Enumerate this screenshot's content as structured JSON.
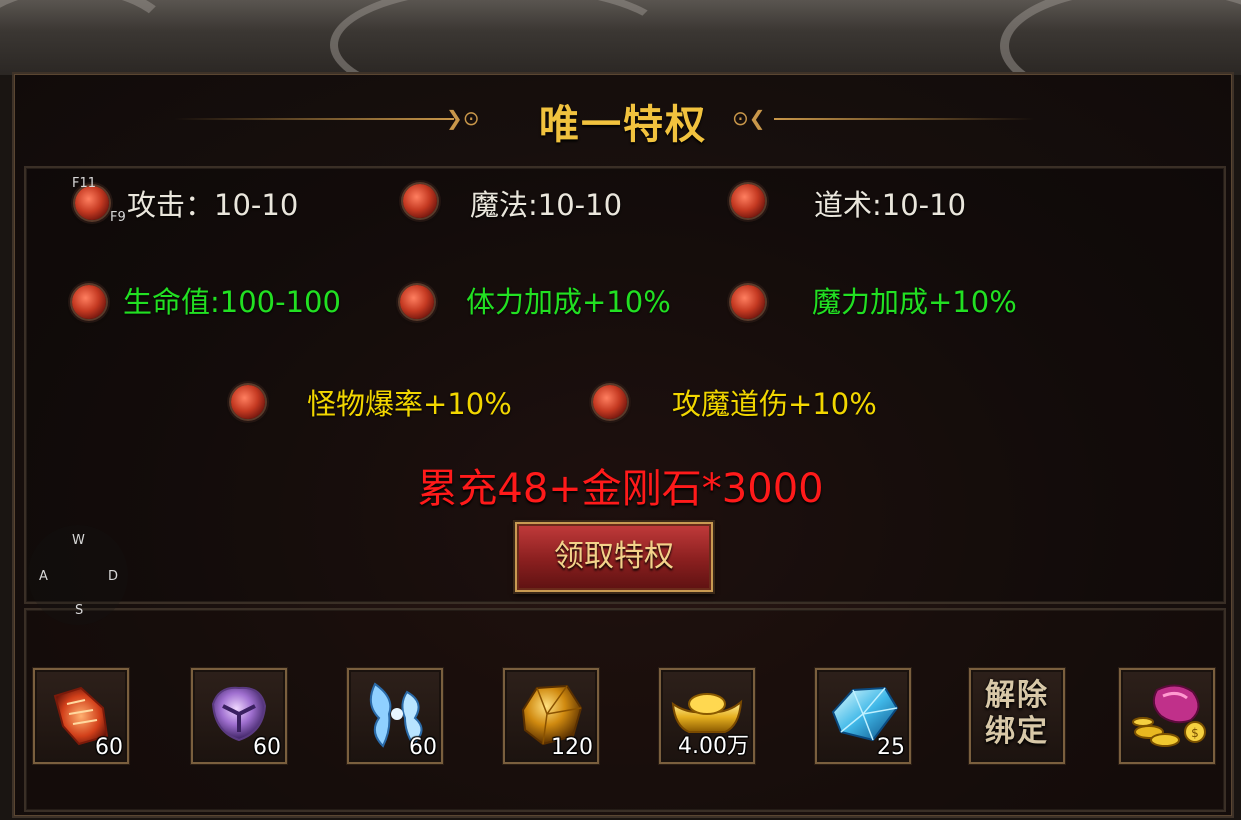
{
  "window": {
    "title": "唯一特权"
  },
  "stats": {
    "row1": [
      {
        "label": "攻击：10-10",
        "color": "#eae6dc"
      },
      {
        "label": "魔法:10-10",
        "color": "#eae6dc"
      },
      {
        "label": "道术:10-10",
        "color": "#eae6dc"
      }
    ],
    "row2": [
      {
        "label": "生命值:100-100",
        "color": "#22e022"
      },
      {
        "label": "体力加成+10%",
        "color": "#22e022"
      },
      {
        "label": "魔力加成+10%",
        "color": "#22e022"
      }
    ],
    "row3": [
      {
        "label": "怪物爆率+10%",
        "color": "#f2d600"
      },
      {
        "label": "攻魔道伤+10%",
        "color": "#f2d600"
      }
    ]
  },
  "hotkeys": {
    "f11": "F11",
    "f9": "F9",
    "w": "W",
    "a": "A",
    "s": "S",
    "d": "D"
  },
  "promo_text": "累充48+金刚石*3000",
  "claim_button": "领取特权",
  "rewards": [
    {
      "icon": "scroll-icon",
      "count": "60"
    },
    {
      "icon": "purple-orb-icon",
      "count": "60"
    },
    {
      "icon": "blue-wings-icon",
      "count": "60"
    },
    {
      "icon": "gold-ore-icon",
      "count": "120"
    },
    {
      "icon": "gold-ingot-icon",
      "count": "4.00万"
    },
    {
      "icon": "diamond-icon",
      "count": "25"
    },
    {
      "icon": "unbind-icon",
      "label": "解除绑定"
    },
    {
      "icon": "money-bag-icon"
    }
  ],
  "colors": {
    "title": "#f1c23e",
    "promo": "#ff1a1a",
    "stat_white": "#eae6dc",
    "stat_green": "#22e022",
    "stat_yellow": "#f2d600"
  }
}
